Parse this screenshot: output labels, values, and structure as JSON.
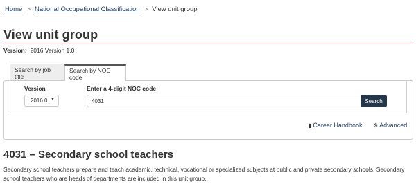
{
  "breadcrumb": {
    "items": [
      {
        "label": "Home"
      },
      {
        "label": "National Occupational Classification"
      }
    ],
    "current": "View unit group",
    "separator": ">"
  },
  "page": {
    "title": "View unit group",
    "version_label": "Version:",
    "version_value": "2016 Version 1.0"
  },
  "tabs": [
    {
      "label": "Search by job title",
      "active": false
    },
    {
      "label": "Search by NOC code",
      "active": true
    }
  ],
  "form": {
    "version_label": "Version",
    "version_selected": "2016.0",
    "noc_label": "Enter a 4-digit NOC code",
    "noc_value": "4031",
    "search_button": "Search"
  },
  "links": {
    "career_handbook": "Career Handbook",
    "advanced": "Advanced"
  },
  "unit_group": {
    "title": "4031 – Secondary school teachers",
    "description": "Secondary school teachers prepare and teach academic, technical, vocational or specialized subjects at public and private secondary schools. Secondary school teachers who are heads of departments are included in this unit group."
  },
  "colors": {
    "link": "#284162",
    "rule": "#af3c43",
    "button": "#26374a"
  }
}
